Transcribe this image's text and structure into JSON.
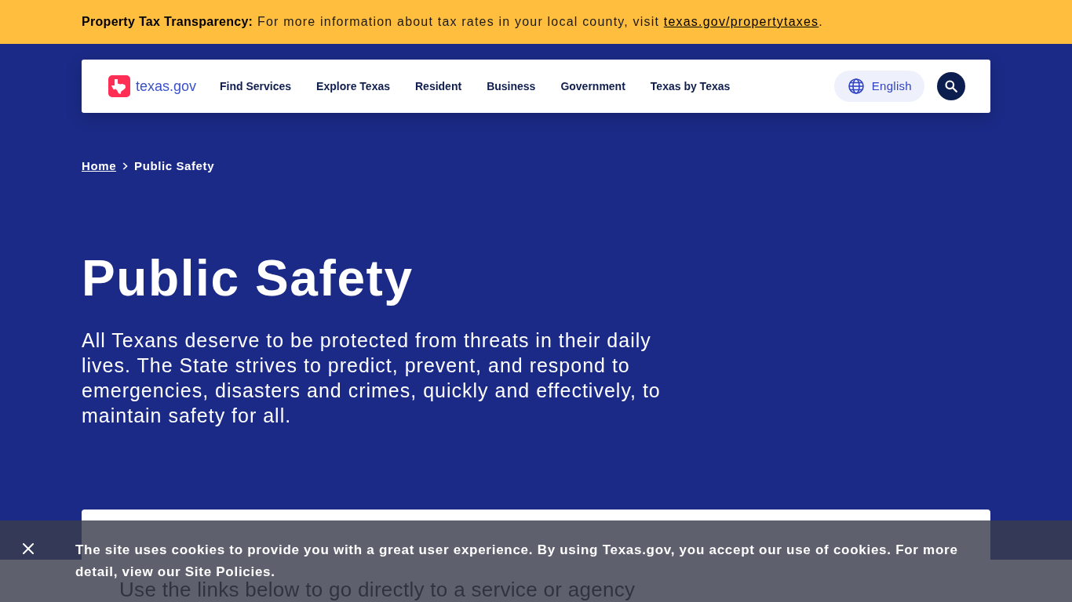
{
  "alert_bar": {
    "text": "**Property Tax Transparency:** For more information about tax rates in your local county, visit",
    "link": "texas.gov/propertytaxes",
    "suffix": "."
  },
  "header": {
    "logo_text": "texas.gov",
    "nav_items": [
      "Find Services",
      "Explore Texas",
      "Resident",
      "Business",
      "Government",
      "Texas by Texas"
    ],
    "language_button": "English"
  },
  "breadcrumb": [
    {
      "label": "Home",
      "kind": "link"
    },
    {
      "label": "Public Safety",
      "kind": "current"
    }
  ],
  "hero": {
    "title": "Public Safety",
    "description": "All Texans deserve to be protected from threats in their daily lives. The State strives to predict, prevent, and respond to emergencies, disasters and crimes, quickly and effectively, to maintain safety for all."
  },
  "quick_links_card": {
    "description": "Use the links below to go directly to a service or agency"
  },
  "cookie_banner": {
    "text": "The site uses cookies to provide you with a great user experience. By using Texas.gov, you accept our use of cookies. For more detail, view our Site Policies."
  }
}
